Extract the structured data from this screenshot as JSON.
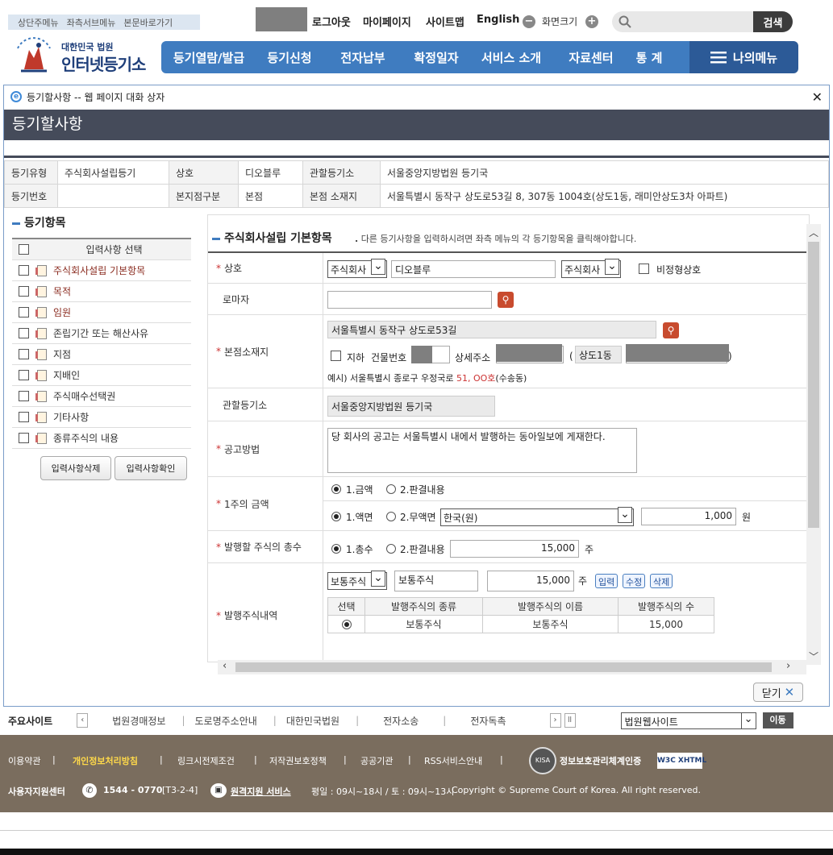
{
  "header": {
    "skip_links": [
      "상단주메뉴",
      "좌측서브메뉴",
      "본문바로가기"
    ],
    "top_links": [
      "로그아웃",
      "마이페이지",
      "사이트맵",
      "English"
    ],
    "font_size_label": "화면크기",
    "search_button": "검색",
    "logo_sub": "대한민국 법원",
    "logo_main": "인터넷등기소",
    "nav": [
      "등기열람/발급",
      "등기신청",
      "전자납부",
      "확정일자",
      "서비스 소개",
      "자료센터",
      "통 계"
    ],
    "my_menu": "나의메뉴"
  },
  "dialog": {
    "window_title": "등기할사항 -- 웹 페이지 대화 상자",
    "heading": "등기할사항",
    "info": {
      "type_label": "등기유형",
      "type_value": "주식회사설립등기",
      "name_label": "상호",
      "name_value": "디오블루",
      "office_label": "관할등기소",
      "office_value": "서울중앙지방법원 등기국",
      "regno_label": "등기번호",
      "regno_value": "",
      "branch_label": "본지점구분",
      "branch_value": "본점",
      "addr_label": "본점 소재지",
      "addr_value": "서울특별시 동작구 상도로53길 8, 307동 1004호(상도1동, 래미안상도3차 아파트)"
    },
    "left_panel": {
      "title": "등기항목",
      "header": "입력사항 선택",
      "items": [
        "주식회사설립 기본항목",
        "목적",
        "임원",
        "존립기간 또는 해산사유",
        "지점",
        "지배인",
        "주식매수선택권",
        "기타사항",
        "종류주식의 내용"
      ],
      "delete_button": "입력사항삭제",
      "confirm_button": "입력사항확인"
    },
    "form": {
      "title": "주식회사설립 기본항목",
      "note": "다른 등기사항을 입력하시려면 좌측 메뉴의 각 등기항목을 클릭해야합니다.",
      "name_label": "상호",
      "name_prefix": "주식회사",
      "name_value": "디오블루",
      "name_suffix": "주식회사",
      "name_nonstandard": "비정형상호",
      "roman_label": "로마자",
      "addr_label": "본점소재지",
      "addr_road": "서울특별시 동작구 상도로53길",
      "basement": "지하",
      "bldg_no_label": "건물번호",
      "detail_label": "상세주소",
      "paren_open": "(",
      "dong": "상도1동",
      "paren_close": ")",
      "addr_example_prefix": "예시) 서울특별시 종로구 우정국로",
      "addr_example_num": "51, OO호",
      "addr_example_suffix": "(수송동)",
      "office_label": "관할등기소",
      "office_value": "서울중앙지방법원  등기국",
      "notice_label": "공고방법",
      "notice_value": "당 회사의 공고는 서울특별시 내에서 발행하는 동아일보에 게재한다.",
      "par_label": "1주의 금액",
      "par_opt1": "1.금액",
      "par_opt2": "2.판결내용",
      "par_sub1": "1.액면",
      "par_sub2": "2.무액면",
      "currency": "한국(원)",
      "par_value": "1,000",
      "won": "원",
      "total_label": "발행할 주식의 총수",
      "total_opt1": "1.총수",
      "total_opt2": "2.판결내용",
      "total_value": "15,000",
      "ju": "주",
      "issued_label": "발행주식내역",
      "issued_kind_select": "보통주식",
      "issued_kind_name": "보통주식",
      "issued_count": "15,000",
      "btn_input": "입력",
      "btn_edit": "수정",
      "btn_delete": "삭제",
      "table_headers": [
        "선택",
        "발행주식의 종류",
        "발행주식의 이름",
        "발행주식의 수"
      ],
      "table_row": {
        "kind": "보통주식",
        "name": "보통주식",
        "count": "15,000"
      }
    },
    "close_button": "닫기"
  },
  "main_sites": {
    "label": "주요사이트",
    "links": [
      "법원경매정보",
      "도로명주소안내",
      "대한민국법원",
      "전자소송",
      "전자독촉"
    ],
    "select": "법원웹사이트",
    "go_button": "이동"
  },
  "footer": {
    "links": [
      "이용약관",
      "개인정보처리방침",
      "링크시전제조건",
      "저작권보호정책",
      "공공기관",
      "RSS서비스안내"
    ],
    "isms": "정보보호관리체계인증",
    "help_label": "사용자지원센터",
    "phone": "1544 - 0770",
    "code": "[T3-2-4]",
    "remote": "원격지원 서비스",
    "hours": "평일 : 09시~18시 / 토 : 09시~13시",
    "copyright": "Copyright © Supreme Court of Korea. All right reserved."
  },
  "colors": {
    "nav": "#3f7cc0",
    "dialog_head": "#454b5a",
    "footer": "#7a6d5e",
    "required": "#cc3333"
  }
}
